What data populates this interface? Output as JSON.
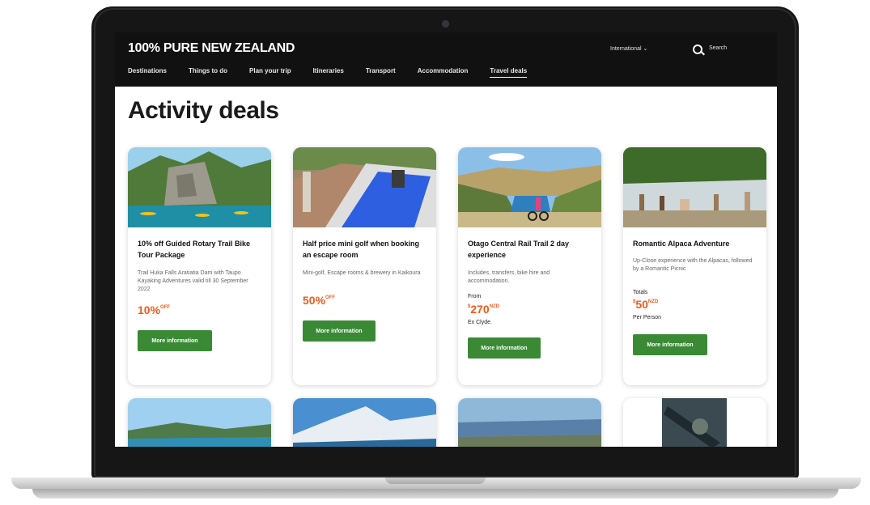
{
  "site": {
    "logo": "100% PURE NEW ZEALAND",
    "region": "International ⌄",
    "search_label": "Search"
  },
  "nav": [
    {
      "label": "Destinations"
    },
    {
      "label": "Things to do"
    },
    {
      "label": "Plan your trip"
    },
    {
      "label": "Itineraries"
    },
    {
      "label": "Transport"
    },
    {
      "label": "Accommodation"
    },
    {
      "label": "Travel deals"
    }
  ],
  "page": {
    "title": "Activity deals"
  },
  "cards": [
    {
      "title": "10% off Guided Rotary Trail Bike Tour Package",
      "description": "Trail Huka Falls Aratiatia Dam with Taupo Kayaking Adventures valid till 30 September 2022",
      "deal": "10%",
      "deal_suffix": "OFF",
      "button": "More information"
    },
    {
      "title": "Half price mini golf when booking an escape room",
      "description": "Mini-golf, Escape rooms & brewery in Kaikoura",
      "deal": "50%",
      "deal_suffix": "OFF",
      "button": "More information"
    },
    {
      "title": "Otago Central Rail Trail 2 day experience",
      "description": "Includes, transfers, bike hire and accommodation.",
      "price_prefix": "From",
      "currency": "$",
      "price": "270",
      "price_unit": "NZD",
      "price_suffix": "Ex Clyde.",
      "button": "More information"
    },
    {
      "title": "Romantic Alpaca Adventure",
      "description": "Up-Close experience with the Alpacas, followed by a Romantic Picnic",
      "price_prefix": "Totals",
      "currency": "$",
      "price": "50",
      "price_unit": "NZD",
      "price_suffix": "Per Person",
      "button": "More information"
    }
  ]
}
